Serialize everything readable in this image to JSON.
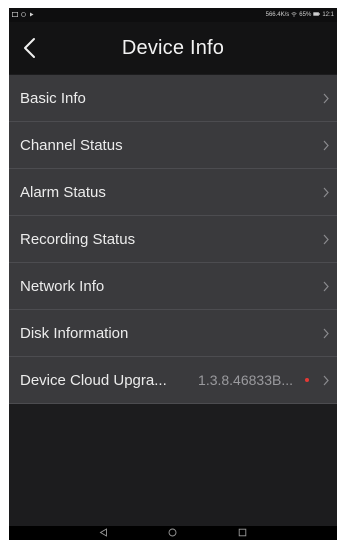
{
  "status_bar": {
    "left_icons": [
      "image-icon",
      "notification-icon",
      "play-icon"
    ],
    "right_text": "566.4K/s",
    "battery": "65%",
    "time": "12:1"
  },
  "header": {
    "title": "Device Info"
  },
  "menu": [
    {
      "label": "Basic Info",
      "value": ""
    },
    {
      "label": "Channel Status",
      "value": ""
    },
    {
      "label": "Alarm Status",
      "value": ""
    },
    {
      "label": "Recording Status",
      "value": ""
    },
    {
      "label": "Network Info",
      "value": ""
    },
    {
      "label": "Disk Information",
      "value": ""
    },
    {
      "label": "Device Cloud Upgra...",
      "value": "1.3.8.46833B...",
      "has_update_dot": true
    }
  ],
  "colors": {
    "background": "#1c1c1e",
    "row": "#3a3a3d",
    "update_dot": "#e53935"
  }
}
